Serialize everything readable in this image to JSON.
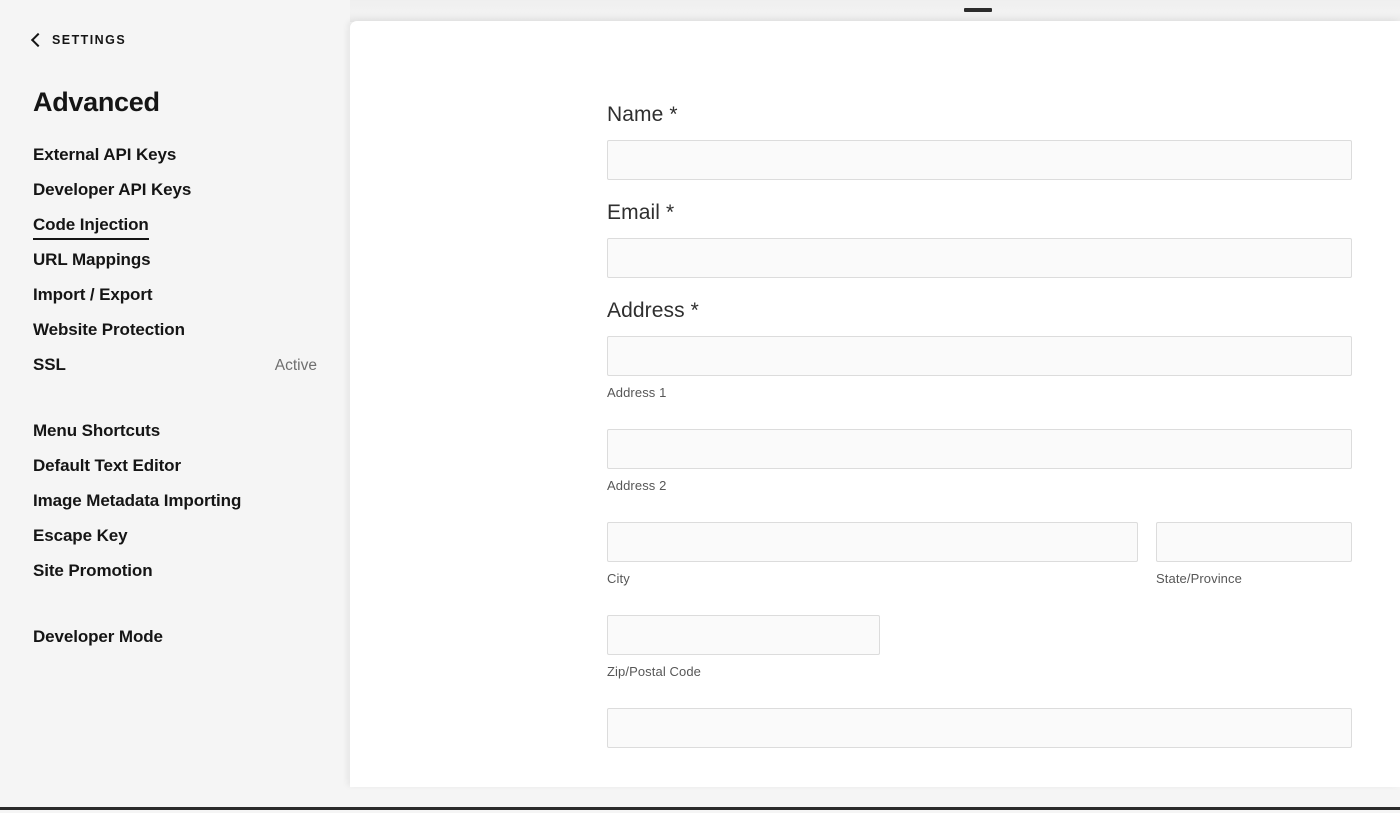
{
  "sidebar": {
    "back": {
      "label": "SETTINGS",
      "icon": "chevron-left-icon"
    },
    "title": "Advanced",
    "groups": [
      {
        "items": [
          {
            "label": "External API Keys",
            "active": false,
            "status": ""
          },
          {
            "label": "Developer API Keys",
            "active": false,
            "status": ""
          },
          {
            "label": "Code Injection",
            "active": true,
            "status": ""
          },
          {
            "label": "URL Mappings",
            "active": false,
            "status": ""
          },
          {
            "label": "Import / Export",
            "active": false,
            "status": ""
          },
          {
            "label": "Website Protection",
            "active": false,
            "status": ""
          },
          {
            "label": "SSL",
            "active": false,
            "status": "Active"
          }
        ]
      },
      {
        "items": [
          {
            "label": "Menu Shortcuts",
            "active": false,
            "status": ""
          },
          {
            "label": "Default Text Editor",
            "active": false,
            "status": ""
          },
          {
            "label": "Image Metadata Importing",
            "active": false,
            "status": ""
          },
          {
            "label": "Escape Key",
            "active": false,
            "status": ""
          },
          {
            "label": "Site Promotion",
            "active": false,
            "status": ""
          }
        ]
      },
      {
        "items": [
          {
            "label": "Developer Mode",
            "active": false,
            "status": ""
          }
        ]
      }
    ]
  },
  "panel": {
    "drag_handle": "panel-drag-handle"
  },
  "form": {
    "name": {
      "label": "Name *",
      "value": "",
      "placeholder": ""
    },
    "email": {
      "label": "Email *",
      "value": "",
      "placeholder": ""
    },
    "address": {
      "label": "Address *",
      "line1": {
        "value": "",
        "placeholder": "",
        "sub_label": "Address 1"
      },
      "line2": {
        "value": "",
        "placeholder": "",
        "sub_label": "Address 2"
      },
      "city": {
        "value": "",
        "placeholder": "",
        "sub_label": "City"
      },
      "state": {
        "value": "",
        "placeholder": "",
        "sub_label": "State/Province"
      },
      "zip": {
        "value": "",
        "placeholder": "",
        "sub_label": "Zip/Postal Code"
      },
      "country": {
        "value": "",
        "placeholder": "",
        "sub_label": ""
      }
    }
  },
  "colors": {
    "sidebar_bg": "#f5f5f5",
    "panel_bg": "#ffffff",
    "text_primary": "#151515",
    "text_secondary": "#575757",
    "status_text": "#6f6f6f",
    "input_bg": "#fafafa",
    "input_border": "#dcdcdc",
    "bottom_rule": "#2b2b2b"
  }
}
